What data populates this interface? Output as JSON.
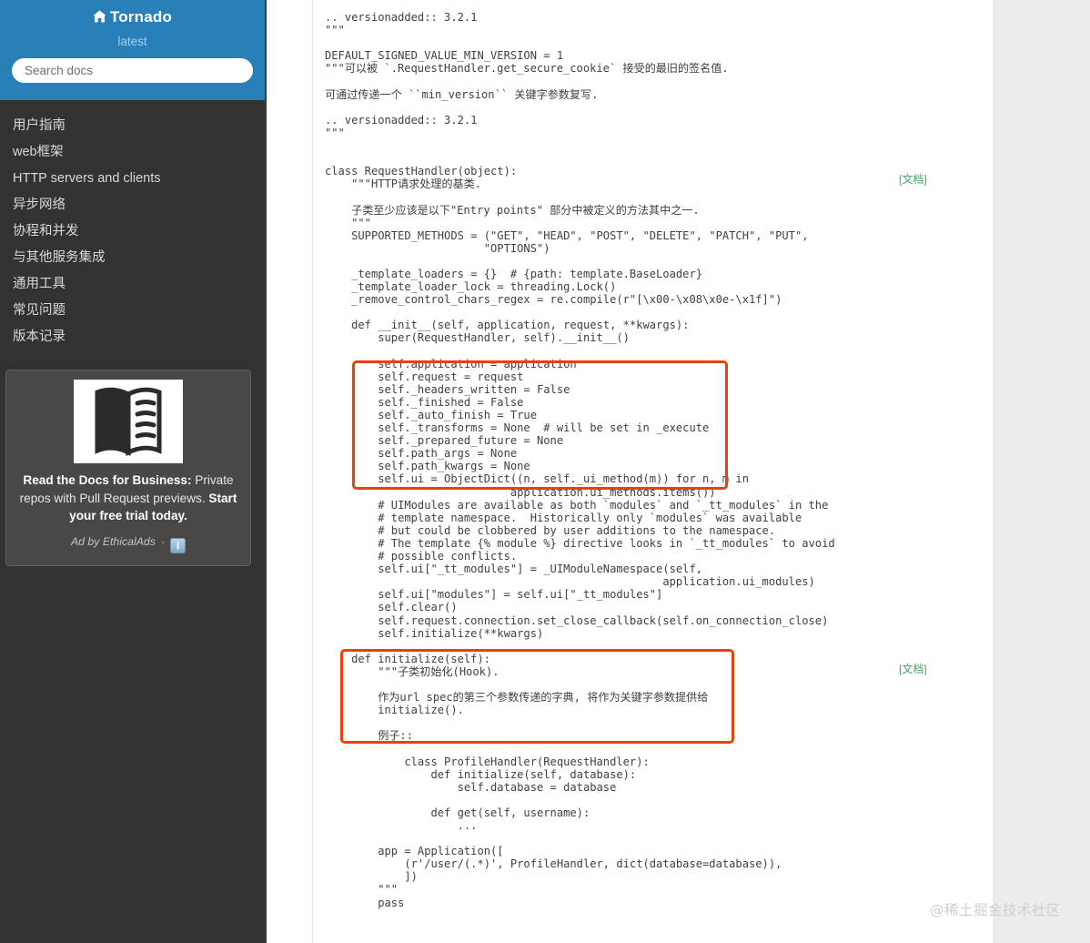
{
  "sidebar": {
    "brand": "Tornado",
    "brand_icon": "home-icon",
    "version": "latest",
    "search_placeholder": "Search docs",
    "search_value": "",
    "nav_items": [
      "用户指南",
      "web框架",
      "HTTP servers and clients",
      "异步网络",
      "协程和并发",
      "与其他服务集成",
      "通用工具",
      "常见问题",
      "版本记录"
    ],
    "header_color": "#2980b9",
    "background_color": "#343131"
  },
  "ad": {
    "image_icon": "open-book-icon",
    "text_part1": "Read the Docs for Business:",
    "text_part2": " Private repos with Pull Request previews. ",
    "text_part3": "Start your free trial today.",
    "byline": "Ad by EthicalAds",
    "separator": "·",
    "info_icon": "i"
  },
  "content": {
    "doc_link_1": "[文档]",
    "doc_link_2": "[文档]",
    "doc_link_color": "#3fa766",
    "annotation_color": "#e8400f",
    "watermark": "@稀土掘金技术社区",
    "code": ".. versionadded:: 3.2.1\n\"\"\"\n\nDEFAULT_SIGNED_VALUE_MIN_VERSION = 1\n\"\"\"可以被 `.RequestHandler.get_secure_cookie` 接受的最旧的签名值.\n\n可通过传递一个 ``min_version`` 关键字参数复写.\n\n.. versionadded:: 3.2.1\n\"\"\"\n\n\nclass RequestHandler(object):\n    \"\"\"HTTP请求处理的基类.\n\n    子类至少应该是以下\"Entry points\" 部分中被定义的方法其中之一.\n    \"\"\"\n    SUPPORTED_METHODS = (\"GET\", \"HEAD\", \"POST\", \"DELETE\", \"PATCH\", \"PUT\",\n                        \"OPTIONS\")\n\n    _template_loaders = {}  # {path: template.BaseLoader}\n    _template_loader_lock = threading.Lock()\n    _remove_control_chars_regex = re.compile(r\"[\\x00-\\x08\\x0e-\\x1f]\")\n\n    def __init__(self, application, request, **kwargs):\n        super(RequestHandler, self).__init__()\n\n        self.application = application\n        self.request = request\n        self._headers_written = False\n        self._finished = False\n        self._auto_finish = True\n        self._transforms = None  # will be set in _execute\n        self._prepared_future = None\n        self.path_args = None\n        self.path_kwargs = None\n        self.ui = ObjectDict((n, self._ui_method(m)) for n, m in\n                            application.ui_methods.items())\n        # UIModules are available as both `modules` and `_tt_modules` in the\n        # template namespace.  Historically only `modules` was available\n        # but could be clobbered by user additions to the namespace.\n        # The template {% module %} directive looks in `_tt_modules` to avoid\n        # possible conflicts.\n        self.ui[\"_tt_modules\"] = _UIModuleNamespace(self,\n                                                   application.ui_modules)\n        self.ui[\"modules\"] = self.ui[\"_tt_modules\"]\n        self.clear()\n        self.request.connection.set_close_callback(self.on_connection_close)\n        self.initialize(**kwargs)\n\n    def initialize(self):\n        \"\"\"子类初始化(Hook).\n\n        作为url spec的第三个参数传递的字典, 将作为关键字参数提供给\n        initialize().\n\n        例子::\n\n            class ProfileHandler(RequestHandler):\n                def initialize(self, database):\n                    self.database = database\n\n                def get(self, username):\n                    ...\n\n        app = Application([\n            (r'/user/(.*)', ProfileHandler, dict(database=database)),\n            ])\n        \"\"\"\n        pass"
  }
}
